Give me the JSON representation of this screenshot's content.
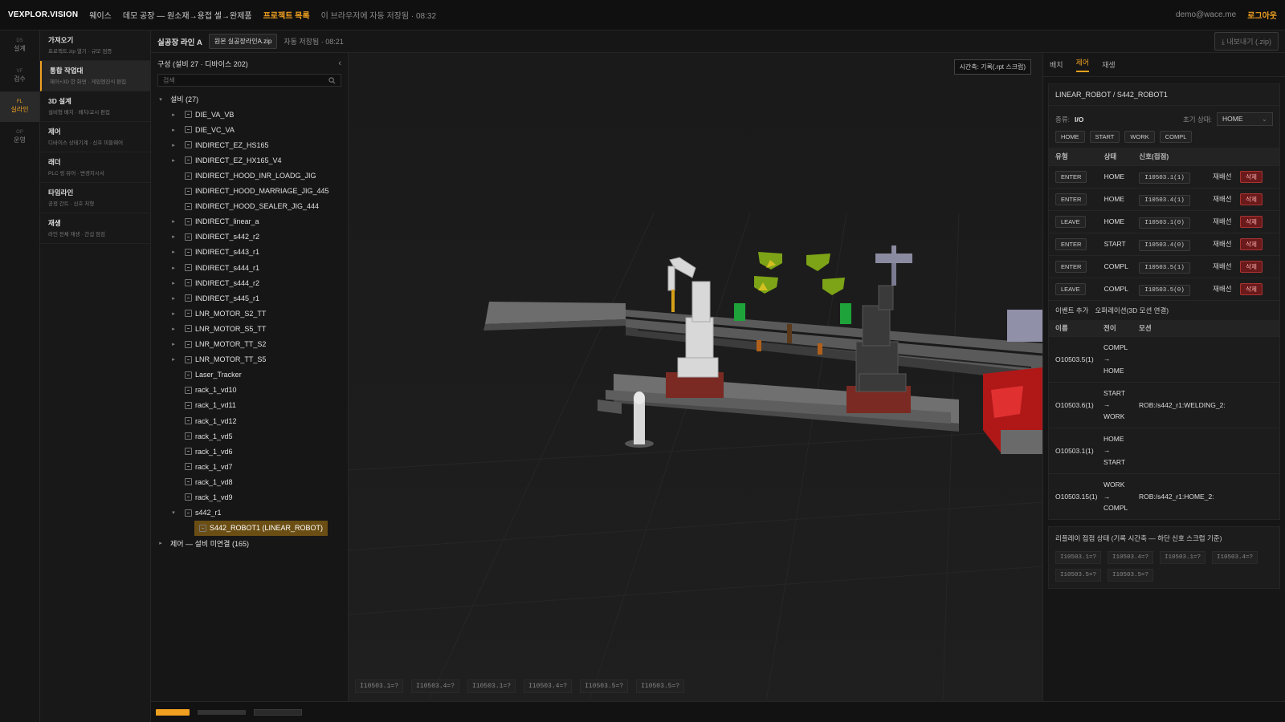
{
  "topbar": {
    "brand": "VEXPLOR.VISION",
    "company": "웨이스",
    "project": "데모 공장 — 원소재→용접 셀→완제품",
    "project_list": "프로젝트 목록",
    "autosave": "이 브라우저에 자동 저장됨 · 08:32",
    "user": "demo@wace.me",
    "logout": "로그아웃"
  },
  "rail": [
    {
      "code": "DS",
      "label": "설계"
    },
    {
      "code": "VF",
      "label": "검수"
    },
    {
      "code": "FL",
      "label": "실라인"
    },
    {
      "code": "OP",
      "label": "운영"
    }
  ],
  "menu": [
    {
      "title": "가져오기",
      "sub": "프로젝트.zip 열기 · 규모 점증"
    },
    {
      "title": "통합 작업대",
      "sub": "제어+3D 한 화면 · 게임엔진식 편집"
    },
    {
      "title": "3D 설계",
      "sub": "설비형 배치 · 배치/교시 편집"
    },
    {
      "title": "제어",
      "sub": "디바이스 상태기계 · 신호 미들웨어"
    },
    {
      "title": "래더",
      "sub": "PLC 링 뷰어 · 변경지시서"
    },
    {
      "title": "타임라인",
      "sub": "공정 간트 · 신호 처형"
    },
    {
      "title": "재생",
      "sub": "라인 전체 재생 · 간섭 점검"
    }
  ],
  "subbar": {
    "line": "실공장 라인 A",
    "file": "원본 실공장라인A.zip",
    "saved": "자동 저장됨 · 08:21",
    "export": "내보내기 (.zip)"
  },
  "tree": {
    "header": "구성 (설비 27 · 디바이스 202)",
    "collapse": "‹",
    "search_placeholder": "검색",
    "group": "설비 (27)",
    "items": [
      {
        "label": "DIE_VA_VB",
        "caret": "▸"
      },
      {
        "label": "DIE_VC_VA",
        "caret": "▸"
      },
      {
        "label": "INDIRECT_EZ_HS165",
        "caret": "▸"
      },
      {
        "label": "INDIRECT_EZ_HX165_V4",
        "caret": "▸"
      },
      {
        "label": "INDIRECT_HOOD_INR_LOADG_JIG",
        "caret": ""
      },
      {
        "label": "INDIRECT_HOOD_MARRIAGE_JIG_445",
        "caret": ""
      },
      {
        "label": "INDIRECT_HOOD_SEALER_JIG_444",
        "caret": ""
      },
      {
        "label": "INDIRECT_linear_a",
        "caret": "▸"
      },
      {
        "label": "INDIRECT_s442_r2",
        "caret": "▸"
      },
      {
        "label": "INDIRECT_s443_r1",
        "caret": "▸"
      },
      {
        "label": "INDIRECT_s444_r1",
        "caret": "▸"
      },
      {
        "label": "INDIRECT_s444_r2",
        "caret": "▸"
      },
      {
        "label": "INDIRECT_s445_r1",
        "caret": "▸"
      },
      {
        "label": "LNR_MOTOR_S2_TT",
        "caret": "▸"
      },
      {
        "label": "LNR_MOTOR_S5_TT",
        "caret": "▸"
      },
      {
        "label": "LNR_MOTOR_TT_S2",
        "caret": "▸"
      },
      {
        "label": "LNR_MOTOR_TT_S5",
        "caret": "▸"
      },
      {
        "label": "Laser_Tracker",
        "caret": ""
      },
      {
        "label": "rack_1_vd10",
        "caret": ""
      },
      {
        "label": "rack_1_vd11",
        "caret": ""
      },
      {
        "label": "rack_1_vd12",
        "caret": ""
      },
      {
        "label": "rack_1_vd5",
        "caret": ""
      },
      {
        "label": "rack_1_vd6",
        "caret": ""
      },
      {
        "label": "rack_1_vd7",
        "caret": ""
      },
      {
        "label": "rack_1_vd8",
        "caret": ""
      },
      {
        "label": "rack_1_vd9",
        "caret": ""
      },
      {
        "label": "s442_r1",
        "caret": "▾"
      }
    ],
    "selected": "S442_ROBOT1 (LINEAR_ROBOT)",
    "group2": "제어 — 설비 미연결 (165)"
  },
  "viewport": {
    "timeline_badge": "시간축: 기록(.rpt 스크럽)",
    "signals": [
      "I10503.1=?",
      "I10503.4=?",
      "I10503.1=?",
      "I10503.4=?",
      "I10503.5=?",
      "I10503.5=?"
    ]
  },
  "right": {
    "tabs": [
      "배치",
      "제어",
      "재생"
    ],
    "active_tab": "제어",
    "title": "LINEAR_ROBOT / S442_ROBOT1",
    "type_label": "종류:",
    "type_value": "I/O",
    "init_label": "초기 상태:",
    "init_value": "HOME",
    "states": [
      "HOME",
      "START",
      "WORK",
      "COMPL"
    ],
    "table_headers": [
      "유형",
      "상태",
      "신호(접점)"
    ],
    "rows": [
      {
        "type": "ENTER",
        "state": "HOME",
        "signal": "I10503.1(1)",
        "rebind": "재배선",
        "del": "삭제"
      },
      {
        "type": "ENTER",
        "state": "HOME",
        "signal": "I10503.4(1)",
        "rebind": "재배선",
        "del": "삭제"
      },
      {
        "type": "LEAVE",
        "state": "HOME",
        "signal": "I10503.1(0)",
        "rebind": "재배선",
        "del": "삭제"
      },
      {
        "type": "ENTER",
        "state": "START",
        "signal": "I10503.4(0)",
        "rebind": "재배선",
        "del": "삭제"
      },
      {
        "type": "ENTER",
        "state": "COMPL",
        "signal": "I10503.5(1)",
        "rebind": "재배선",
        "del": "삭제"
      },
      {
        "type": "LEAVE",
        "state": "COMPL",
        "signal": "I10503.5(0)",
        "rebind": "재배선",
        "del": "삭제"
      }
    ],
    "event_add": "이벤트 추가",
    "orch_title": "오퍼레이션(3D 모션 연결)",
    "op_headers": [
      "이름",
      "전이",
      "모션"
    ],
    "ops": [
      {
        "name": "O10503.5(1)",
        "from": "COMPL",
        "to": "HOME",
        "motion": ""
      },
      {
        "name": "O10503.6(1)",
        "from": "START",
        "to": "WORK",
        "motion": "ROB:/s442_r1:WELDING_2:"
      },
      {
        "name": "O10503.1(1)",
        "from": "HOME",
        "to": "START",
        "motion": ""
      },
      {
        "name": "O10503.15(1)",
        "from": "WORK",
        "to": "COMPL",
        "motion": "ROB:/s442_r1:HOME_2:"
      }
    ],
    "arrow": "→",
    "replay_title": "리플레이 접점 상태 (기록 시간축 — 하단 신호 스크럽 기준)",
    "replay_signals": [
      "I10503.1=?",
      "I10503.4=?",
      "I10503.1=?",
      "I10503.4=?",
      "I10503.5=?",
      "I10503.5=?"
    ]
  },
  "colors": {
    "accent": "#f0a020",
    "bg": "#141414",
    "danger": "#c33"
  }
}
